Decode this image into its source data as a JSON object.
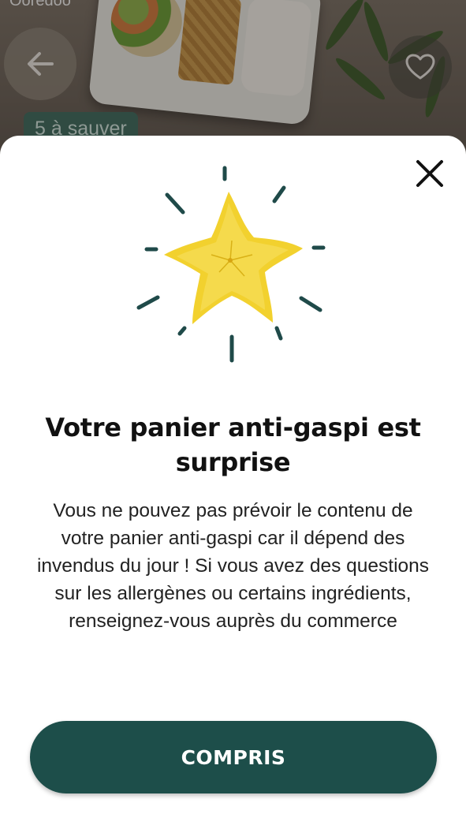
{
  "status_bar": {
    "carrier": "Ooredoo"
  },
  "header": {
    "back_icon": "arrow-left-icon",
    "favorite_icon": "heart-icon",
    "badge_text": "5 à sauver"
  },
  "modal": {
    "close_icon": "close-icon",
    "illustration": "starfruit-illustration",
    "title": "Votre panier anti-gaspi est surprise",
    "description": "Vous ne pouvez pas prévoir le contenu de votre panier anti-gaspi car il dépend des invendus du jour ! Si vous avez des questions sur les allergènes ou certains ingrédients, renseignez-vous auprès du commerce",
    "button_label": "COMPRIS"
  },
  "colors": {
    "primary": "#1d4e4a",
    "star": "#f2d12e",
    "rays": "#1f4a49",
    "badge": "#3f6b5c"
  }
}
